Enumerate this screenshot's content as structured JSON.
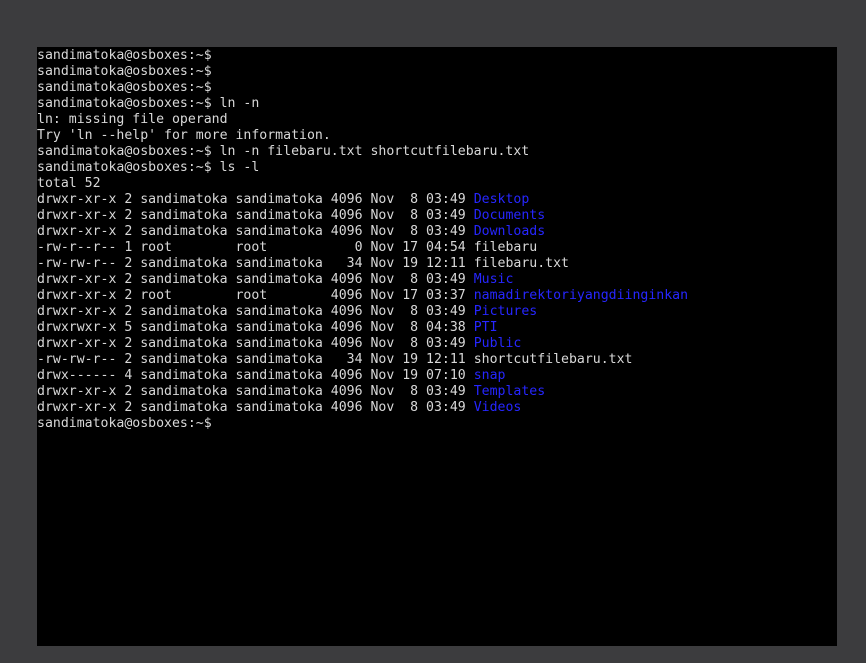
{
  "terminal": {
    "lines": [
      {
        "text": "sandimatoka@osboxes:~$"
      },
      {
        "text": "sandimatoka@osboxes:~$"
      },
      {
        "text": "sandimatoka@osboxes:~$"
      },
      {
        "text": "sandimatoka@osboxes:~$ ln -n"
      },
      {
        "text": "ln: missing file operand"
      },
      {
        "text": "Try 'ln --help' for more information."
      },
      {
        "text": "sandimatoka@osboxes:~$ ln -n filebaru.txt shortcutfilebaru.txt"
      },
      {
        "text": "sandimatoka@osboxes:~$ ls -l"
      },
      {
        "text": "total 52"
      },
      {
        "text": "drwxr-xr-x 2 sandimatoka sandimatoka 4096 Nov  8 03:49 ",
        "name": "Desktop",
        "is_dir": true
      },
      {
        "text": "drwxr-xr-x 2 sandimatoka sandimatoka 4096 Nov  8 03:49 ",
        "name": "Documents",
        "is_dir": true
      },
      {
        "text": "drwxr-xr-x 2 sandimatoka sandimatoka 4096 Nov  8 03:49 ",
        "name": "Downloads",
        "is_dir": true
      },
      {
        "text": "-rw-r--r-- 1 root        root           0 Nov 17 04:54 ",
        "name": "filebaru",
        "is_dir": false
      },
      {
        "text": "-rw-rw-r-- 2 sandimatoka sandimatoka   34 Nov 19 12:11 ",
        "name": "filebaru.txt",
        "is_dir": false
      },
      {
        "text": "drwxr-xr-x 2 sandimatoka sandimatoka 4096 Nov  8 03:49 ",
        "name": "Music",
        "is_dir": true
      },
      {
        "text": "drwxr-xr-x 2 root        root        4096 Nov 17 03:37 ",
        "name": "namadirektoriyangdiinginkan",
        "is_dir": true
      },
      {
        "text": "drwxr-xr-x 2 sandimatoka sandimatoka 4096 Nov  8 03:49 ",
        "name": "Pictures",
        "is_dir": true
      },
      {
        "text": "drwxrwxr-x 5 sandimatoka sandimatoka 4096 Nov  8 04:38 ",
        "name": "PTI",
        "is_dir": true
      },
      {
        "text": "drwxr-xr-x 2 sandimatoka sandimatoka 4096 Nov  8 03:49 ",
        "name": "Public",
        "is_dir": true
      },
      {
        "text": "-rw-rw-r-- 2 sandimatoka sandimatoka   34 Nov 19 12:11 ",
        "name": "shortcutfilebaru.txt",
        "is_dir": false
      },
      {
        "text": "drwx------ 4 sandimatoka sandimatoka 4096 Nov 19 07:10 ",
        "name": "snap",
        "is_dir": true
      },
      {
        "text": "drwxr-xr-x 2 sandimatoka sandimatoka 4096 Nov  8 03:49 ",
        "name": "Templates",
        "is_dir": true
      },
      {
        "text": "drwxr-xr-x 2 sandimatoka sandimatoka 4096 Nov  8 03:49 ",
        "name": "Videos",
        "is_dir": true
      },
      {
        "text": "sandimatoka@osboxes:~$"
      }
    ],
    "colors": {
      "background": "#000000",
      "text": "#d8d8d8",
      "directory": "#2626ff",
      "frame": "#3c3c3e"
    }
  }
}
